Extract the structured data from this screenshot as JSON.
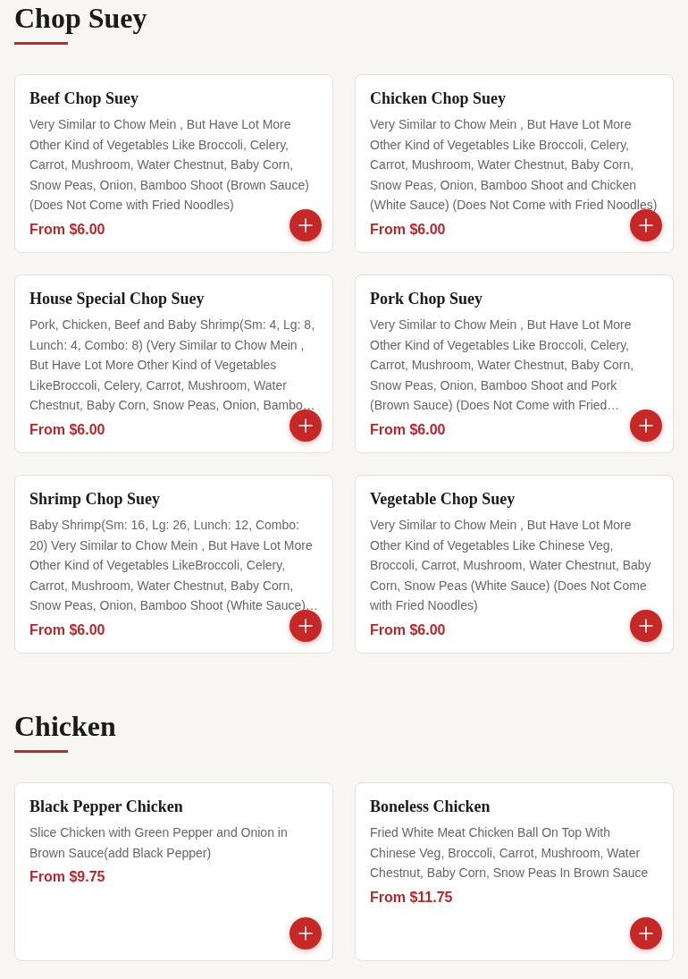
{
  "sections": [
    {
      "title": "Chop Suey",
      "items": [
        {
          "name": "Beef Chop Suey",
          "description": "Very Similar to Chow Mein , But Have Lot More Other Kind of Vegetables Like Broccoli, Celery, Carrot, Mushroom, Water Chestnut, Baby Corn, Snow Peas, Onion, Bamboo Shoot (Brown Sauce) (Does Not Come with Fried Noodles)",
          "price": "From $6.00"
        },
        {
          "name": "Chicken Chop Suey",
          "description": "Very Similar to Chow Mein , But Have Lot More Other Kind of Vegetables Like Broccoli, Celery, Carrot, Mushroom, Water Chestnut, Baby Corn, Snow Peas, Onion, Bamboo Shoot and Chicken (White Sauce) (Does Not Come with Fried Noodles)",
          "price": "From $6.00"
        },
        {
          "name": "House Special Chop Suey",
          "description": "Pork, Chicken, Beef and Baby Shrimp(Sm: 4, Lg: 8, Lunch: 4, Combo: 8) (Very Similar to Chow Mein , But Have Lot More Other Kind of Vegetables LikeBroccoli, Celery, Carrot, Mushroom, Water Chestnut, Baby Corn, Snow Peas, Onion, Bambo…",
          "price": "From $6.00"
        },
        {
          "name": "Pork Chop Suey",
          "description": "Very Similar to Chow Mein , But Have Lot More Other Kind of Vegetables Like Broccoli, Celery, Carrot, Mushroom, Water Chestnut, Baby Corn, Snow Peas, Onion, Bamboo Shoot and Pork (Brown Sauce) (Does Not Come with Fried…",
          "price": "From $6.00"
        },
        {
          "name": "Shrimp Chop Suey",
          "description": "Baby Shrimp(Sm: 16, Lg: 26, Lunch: 12, Combo: 20) Very Similar to Chow Mein , But Have Lot More Other Kind of Vegetables LikeBroccoli, Celery, Carrot, Mushroom, Water Chestnut, Baby Corn, Snow Peas, Onion, Bamboo Shoot (White Sauce)…",
          "price": "From $6.00"
        },
        {
          "name": "Vegetable Chop Suey",
          "description": "Very Similar to Chow Mein , But Have Lot More Other Kind of Vegetables Like Chinese Veg, Broccoli, Carrot, Mushroom, Water Chestnut, Baby Corn, Snow Peas (White Sauce) (Does Not Come with Fried Noodles)",
          "price": "From $6.00"
        }
      ]
    },
    {
      "title": "Chicken",
      "items": [
        {
          "name": "Black Pepper Chicken",
          "description": "Slice Chicken with Green Pepper and Onion in Brown Sauce(add Black Pepper)",
          "price": "From $9.75"
        },
        {
          "name": "Boneless Chicken",
          "description": "Fried White Meat Chicken Ball On Top With Chinese Veg, Broccoli, Carrot, Mushroom, Water Chestnut, Baby Corn, Snow Peas In Brown Sauce",
          "price": "From $11.75"
        }
      ]
    }
  ]
}
